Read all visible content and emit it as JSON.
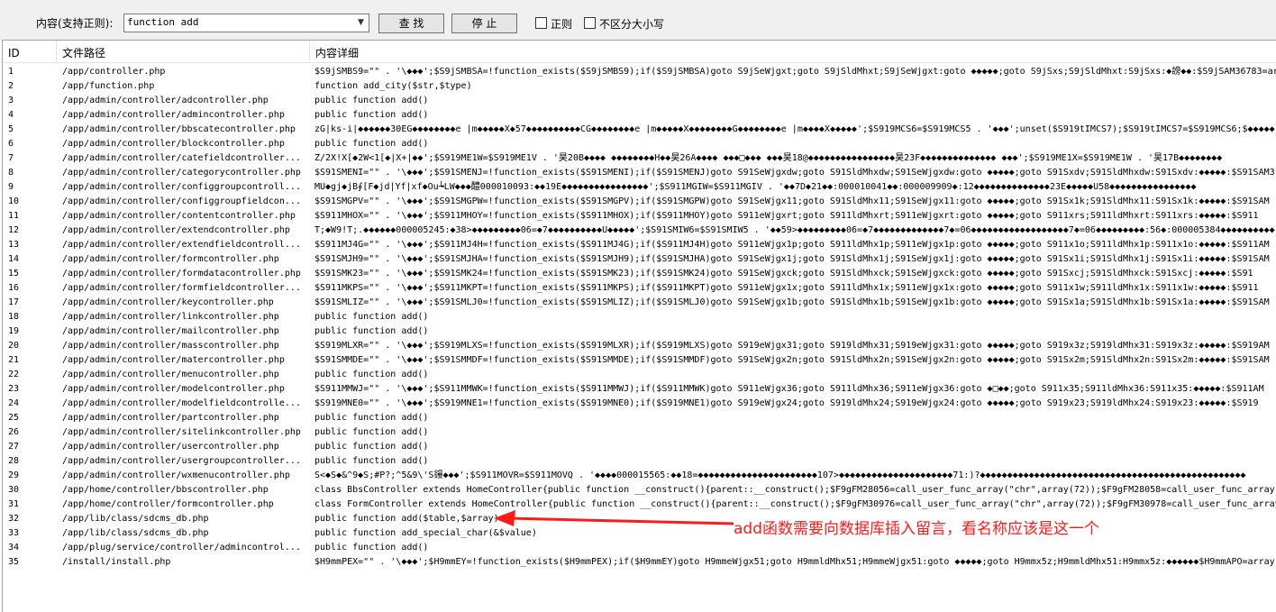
{
  "toolbar": {
    "search_label": "内容(支持正则):",
    "search_value": "function add",
    "find_label": "查 找",
    "stop_label": "停 止",
    "regex_label": "正则",
    "case_label": "不区分大小写"
  },
  "table": {
    "headers": {
      "id": "ID",
      "path": "文件路径",
      "content": "内容详细"
    },
    "rows": [
      {
        "id": "1",
        "path": "/app/controller.php",
        "content": "$S9jSMBS9=\"\" . '\\◆◆◆';$S9jSMBSA=!function_exists($S9jSMBS9);if($S9jSMBSA)goto S9jSeWjgxt;goto S9jSldMhxt;S9jSeWjgxt:goto ◆◆◆◆◆;goto S9jSxs;S9jSldMhxt:S9jSxs:◆謗◆◆:$S9jSAM36783=ar"
      },
      {
        "id": "2",
        "path": "/app/function.php",
        "content": "function add_city($str,$type)"
      },
      {
        "id": "3",
        "path": "/app/admin/controller/adcontroller.php",
        "content": "public function add()"
      },
      {
        "id": "4",
        "path": "/app/admin/controller/admincontroller.php",
        "content": "public function add()"
      },
      {
        "id": "5",
        "path": "/app/admin/controller/bbscatecontroller.php",
        "content": "zG|ks-i|◆◆◆◆◆◆30EG◆◆◆◆◆◆◆◆e |m◆◆◆◆◆X◆57◆◆◆◆◆◆◆◆◆◆CG◆◆◆◆◆◆◆◆e |m◆◆◆◆◆X◆◆◆◆◆◆◆◆G◆◆◆◆◆◆◆◆e |m◆◆◆◆X◆◆◆◆◆';$S919MCS6=$S919MCS5 . '◆◆◆';unset($S919tIMCS7);$S919tIMCS7=$S919MCS6;$◆◆◆◆◆"
      },
      {
        "id": "6",
        "path": "/app/admin/controller/blockcontroller.php",
        "content": "public function add()"
      },
      {
        "id": "7",
        "path": "/app/admin/controller/catefieldcontroller...",
        "content": "Z/2X!X[◆2W<1[◆|X+|◆◆';$S919ME1W=$S919ME1V . '昊20B◆◆◆◆  ◆◆◆◆◆◆◆◆H◆◆昊26A◆◆◆◆  ◆◆◆□◆◆◆  ◆◆◆昊18@◆◆◆◆◆◆◆◆◆◆◆◆◆◆◆◆昊23F◆◆◆◆◆◆◆◆◆◆◆◆◆◆  ◆◆◆';$S919ME1X=$S919ME1W . '昊17B◆◆◆◆◆◆◆◆"
      },
      {
        "id": "8",
        "path": "/app/admin/controller/categorycontroller.php",
        "content": "$S91SMENI=\"\" . '\\◆◆◆';$S91SMENJ=!function_exists($S91SMENI);if($S91SMENJ)goto S91SeWjgxdw;goto S91SldMhxdw;S91SeWjgxdw:goto ◆◆◆◆◆;goto S91Sxdv;S91SldMhxdw:S91Sxdv:◆◆◆◆◆:$S91SAM3"
      },
      {
        "id": "9",
        "path": "/app/admin/controller/configgroupcontroll...",
        "content": "MU◆gj◆jB∮[F◆jd|Yf|xf◆Ou┶LW◆◆◆醴000010093:◆◆19E◆◆◆◆◆◆◆◆◆◆◆◆◆◆◆◆';$S911MGIW=$S911MGIV . '◆◆7D◆21◆◆:000010041◆◆:000009909◆:12◆◆◆◆◆◆◆◆◆◆◆◆◆◆23E◆◆◆◆◆U58◆◆◆◆◆◆◆◆◆◆◆◆◆◆◆◆"
      },
      {
        "id": "10",
        "path": "/app/admin/controller/configgroupfieldcon...",
        "content": "$S91SMGPV=\"\" . '\\◆◆◆';$S91SMGPW=!function_exists($S91SMGPV);if($S91SMGPW)goto S91SeWjgx11;goto S91SldMhx11;S91SeWjgx11:goto ◆◆◆◆◆;goto S91Sx1k;S91SldMhx11:S91Sx1k:◆◆◆◆◆:$S91SAM"
      },
      {
        "id": "11",
        "path": "/app/admin/controller/contentcontroller.php",
        "content": "$S911MHOX=\"\" . '\\◆◆◆';$S911MHOY=!function_exists($S911MHOX);if($S911MHOY)goto S911eWjgxrt;goto S911ldMhxrt;S911eWjgxrt:goto ◆◆◆◆◆;goto S911xrs;S911ldMhxrt:S911xrs:◆◆◆◆◆:$S911"
      },
      {
        "id": "12",
        "path": "/app/admin/controller/extendcontroller.php",
        "content": "T;◆W9!T;.◆◆◆◆◆◆000005245:◆38>◆◆◆◆◆◆◆◆◆06=◆7◆◆◆◆◆◆◆◆◆◆U◆◆◆◆◆';$S91SMIW6=$S91SMIW5 . '◆◆59>◆◆◆◆◆◆◆◆◆06=◆7◆◆◆◆◆◆◆◆◆◆◆◆◆7◆=06◆◆◆◆◆◆◆◆◆◆◆◆◆◆◆◆◆◆7◆=06◆◆◆◆◆◆◆◆◆:56◆:000005384◆◆◆◆◆◆◆◆◆◆"
      },
      {
        "id": "13",
        "path": "/app/admin/controller/extendfieldcontroll...",
        "content": "$S911MJ4G=\"\" . '\\◆◆◆';$S911MJ4H=!function_exists($S911MJ4G);if($S911MJ4H)goto S911eWjgx1p;goto S911ldMhx1p;S911eWjgx1p:goto ◆◆◆◆◆;goto S911x1o;S911ldMhx1p:S911x1o:◆◆◆◆◆:$S911AM"
      },
      {
        "id": "14",
        "path": "/app/admin/controller/formcontroller.php",
        "content": "$S91SMJH9=\"\" . '\\◆◆◆';$S91SMJHA=!function_exists($S91SMJH9);if($S91SMJHA)goto S91SeWjgx1j;goto S91SldMhx1j;S91SeWjgx1j:goto ◆◆◆◆◆;goto S91Sx1i;S91SldMhx1j:S91Sx1i:◆◆◆◆◆:$S91SAM"
      },
      {
        "id": "15",
        "path": "/app/admin/controller/formdatacontroller.php",
        "content": "$S91SMK23=\"\" . '\\◆◆◆';$S91SMK24=!function_exists($S91SMK23);if($S91SMK24)goto S91SeWjgxck;goto S91SldMhxck;S91SeWjgxck:goto ◆◆◆◆◆;goto S91Sxcj;S91SldMhxck:S91Sxcj:◆◆◆◆◆:$S91"
      },
      {
        "id": "16",
        "path": "/app/admin/controller/formfieldcontroller...",
        "content": "$S911MKPS=\"\" . '\\◆◆◆';$S911MKPT=!function_exists($S911MKPS);if($S911MKPT)goto S911eWjgx1x;goto S911ldMhx1x;S911eWjgx1x:goto ◆◆◆◆◆;goto S911x1w;S911ldMhx1x:S911x1w:◆◆◆◆◆:$S911"
      },
      {
        "id": "17",
        "path": "/app/admin/controller/keycontroller.php",
        "content": "$S91SMLIZ=\"\" . '\\◆◆◆';$S91SMLJ0=!function_exists($S91SMLIZ);if($S91SMLJ0)goto S91SeWjgx1b;goto S91SldMhx1b;S91SeWjgx1b:goto ◆◆◆◆◆;goto S91Sx1a;S91SldMhx1b:S91Sx1a:◆◆◆◆◆:$S91SAM"
      },
      {
        "id": "18",
        "path": "/app/admin/controller/linkcontroller.php",
        "content": "public function add()"
      },
      {
        "id": "19",
        "path": "/app/admin/controller/mailcontroller.php",
        "content": "public function add()"
      },
      {
        "id": "20",
        "path": "/app/admin/controller/masscontroller.php",
        "content": "$S919MLXR=\"\" . '\\◆◆◆';$S919MLXS=!function_exists($S919MLXR);if($S919MLXS)goto S919eWjgx31;goto S919ldMhx31;S919eWjgx31:goto ◆◆◆◆◆;goto S919x3z;S919ldMhx31:S919x3z:◆◆◆◆◆:$S919AM"
      },
      {
        "id": "21",
        "path": "/app/admin/controller/matercontroller.php",
        "content": "$S91SMMDE=\"\" . '\\◆◆◆';$S91SMMDF=!function_exists($S91SMMDE);if($S91SMMDF)goto S91SeWjgx2n;goto S91SldMhx2n;S91SeWjgx2n:goto ◆◆◆◆◆;goto S91Sx2m;S91SldMhx2n:S91Sx2m:◆◆◆◆◆:$S91SAM"
      },
      {
        "id": "22",
        "path": "/app/admin/controller/menucontroller.php",
        "content": "public function add()"
      },
      {
        "id": "23",
        "path": "/app/admin/controller/modelcontroller.php",
        "content": "$S911MMWJ=\"\" . '\\◆◆◆';$S911MMWK=!function_exists($S911MMWJ);if($S911MMWK)goto S911eWjgx36;goto S911ldMhx36;S911eWjgx36:goto ◆□◆◆;goto S911x35;S911ldMhx36:S911x35:◆◆◆◆◆:$S911AM"
      },
      {
        "id": "24",
        "path": "/app/admin/controller/modelfieldcontrolle...",
        "content": "$S919MNE0=\"\" . '\\◆◆◆';$S919MNE1=!function_exists($S919MNE0);if($S919MNE1)goto S919eWjgx24;goto S919ldMhx24;S919eWjgx24:goto ◆◆◆◆◆;goto S919x23;S919ldMhx24:S919x23:◆◆◆◆◆:$S919"
      },
      {
        "id": "25",
        "path": "/app/admin/controller/partcontroller.php",
        "content": "public function add()"
      },
      {
        "id": "26",
        "path": "/app/admin/controller/sitelinkcontroller.php",
        "content": "public function add()"
      },
      {
        "id": "27",
        "path": "/app/admin/controller/usercontroller.php",
        "content": "public function add()"
      },
      {
        "id": "28",
        "path": "/app/admin/controller/usergroupcontroller...",
        "content": "public function add()"
      },
      {
        "id": "29",
        "path": "/app/admin/controller/wxmenucontroller.php",
        "content": "S<◆S◆&^9◆S;#P?;^5&9\\'S䜱◆◆◆';$S911MOVR=$S911MOVQ . '◆◆◆◆000015565:◆◆18=◆◆◆◆◆◆◆◆◆◆◆◆◆◆◆◆◆◆◆◆◆◆107>◆◆◆◆◆◆◆◆◆◆◆◆◆◆◆◆◆◆◆◆◆71:)?◆◆◆◆◆◆◆◆◆◆◆◆◆◆◆◆◆◆◆◆◆◆◆◆◆◆◆◆◆◆◆◆◆◆◆◆◆◆◆◆◆◆◆◆◆◆◆◆◆"
      },
      {
        "id": "30",
        "path": "/app/home/controller/bbscontroller.php",
        "content": "class BbsController extends HomeController{public function __construct(){parent::__construct();$F9gFM28056=call_user_func_array(\"chr\",array(72));$F9gFM28058=call_user_func_array("
      },
      {
        "id": "31",
        "path": "/app/home/controller/formcontroller.php",
        "content": "class FormController extends HomeController{public function __construct(){parent::__construct();$F9gFM30976=call_user_func_array(\"chr\",array(72));$F9gFM30978=call_user_func_array("
      },
      {
        "id": "32",
        "path": "/app/lib/class/sdcms_db.php",
        "content": "public function add($table,$array)"
      },
      {
        "id": "33",
        "path": "/app/lib/class/sdcms_db.php",
        "content": "public function add_special_char(&$value)"
      },
      {
        "id": "34",
        "path": "/app/plug/service/controller/admincontrol...",
        "content": "public function add()"
      },
      {
        "id": "35",
        "path": "/install/install.php",
        "content": "$H9mmPEX=\"\" . '\\◆◆◆';$H9mmEY=!function_exists($H9mmPEX);if($H9mmEY)goto H9mmeWjgx51;goto H9mmldMhx51;H9mmeWjgx51:goto ◆◆◆◆◆;goto H9mmx5z;H9mmldMhx51:H9mmx5z:◆◆◆◆◆◆$H9mmAPO=array("
      }
    ]
  },
  "annotation": {
    "text": "add函数需要向数据库插入留言，看名称应该是这一个",
    "color": "#ff1a1a"
  }
}
